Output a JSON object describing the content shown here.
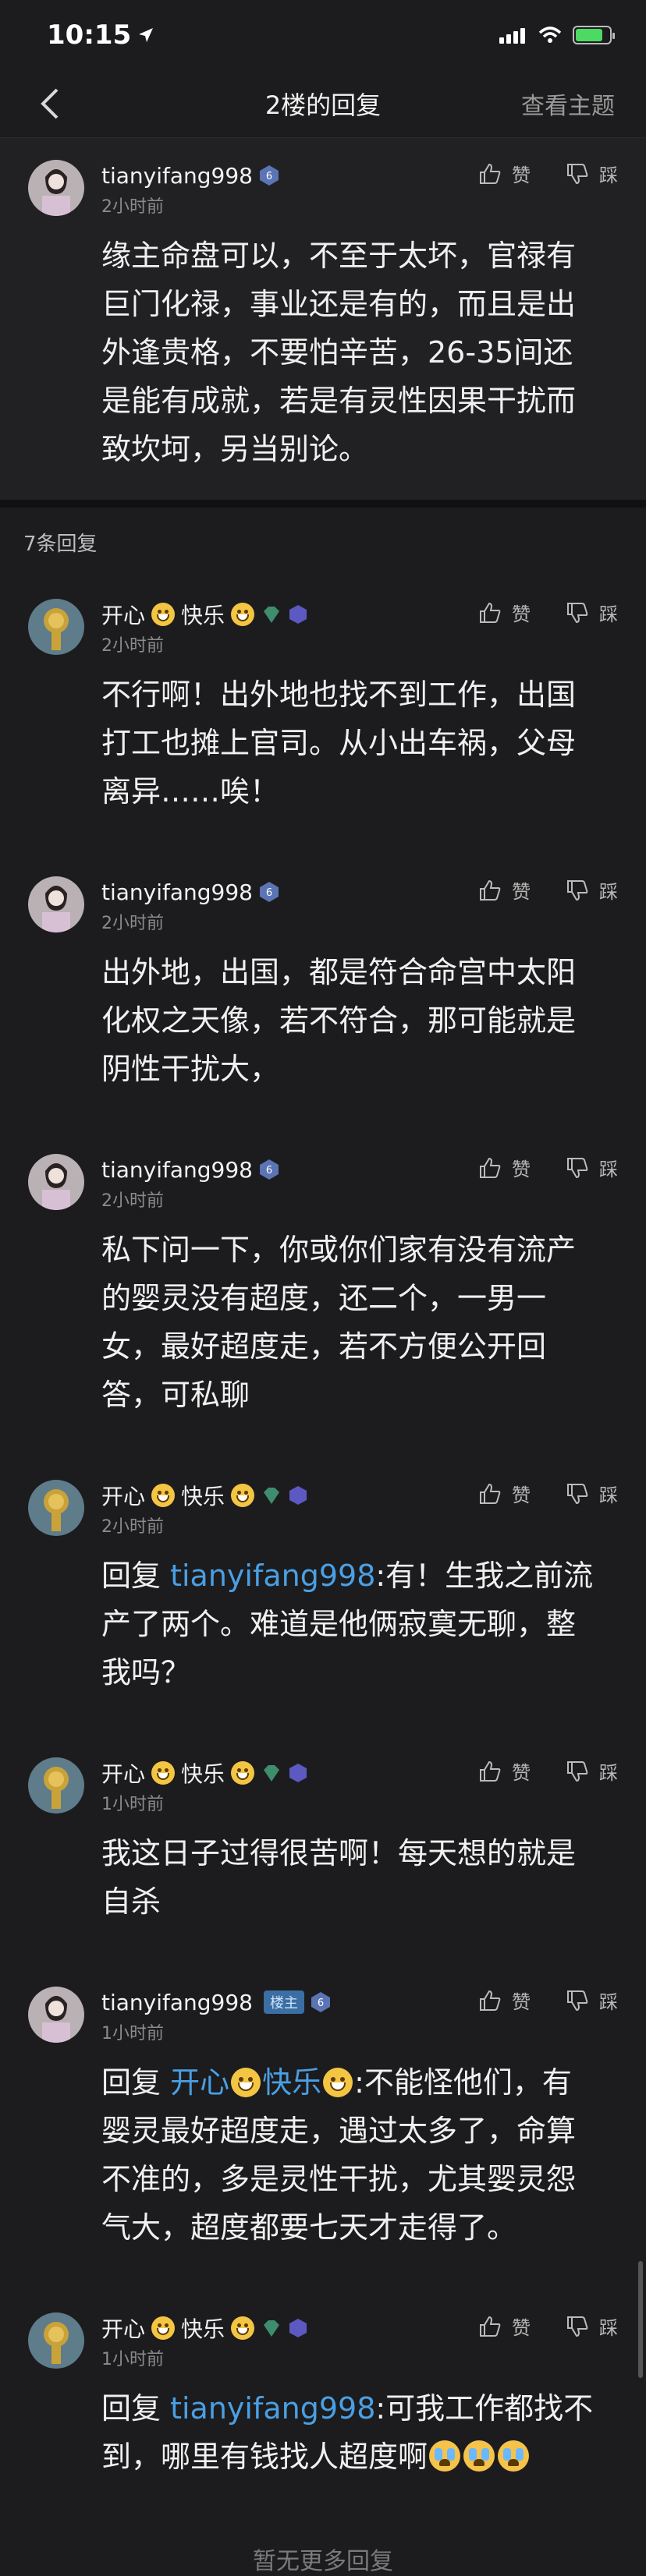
{
  "status_bar": {
    "time": "10:15"
  },
  "nav": {
    "title": "2楼的回复",
    "topic_link": "查看主题"
  },
  "op": {
    "username": "tianyifang998",
    "level": "6",
    "time": "2小时前",
    "like_label": "赞",
    "dislike_label": "踩",
    "content": "缘主命盘可以，不至于太坏，官禄有巨门化禄，事业还是有的，而且是出外逢贵格，不要怕辛苦，26-35间还是能有成就，若是有灵性因果干扰而致坎坷，另当别论。"
  },
  "replies_count": "7条回复",
  "replies": [
    {
      "user_a": "开心",
      "user_b": "快乐",
      "time": "2小时前",
      "content": "不行啊！出外地也找不到工作，出国打工也摊上官司。从小出车祸，父母离异……唉！"
    },
    {
      "username": "tianyifang998",
      "level": "6",
      "time": "2小时前",
      "content": "出外地，出国，都是符合命宫中太阳化权之天像，若不符合，那可能就是阴性干扰大，"
    },
    {
      "username": "tianyifang998",
      "level": "6",
      "time": "2小时前",
      "content": "私下问一下，你或你们家有没有流产的婴灵没有超度，还二个，一男一女，最好超度走，若不方便公开回答，可私聊"
    },
    {
      "user_a": "开心",
      "user_b": "快乐",
      "time": "2小时前",
      "reply_prefix": "回复 ",
      "mention": "tianyifang998",
      "content": ":有！生我之前流产了两个。难道是他俩寂寞无聊，整我吗？"
    },
    {
      "user_a": "开心",
      "user_b": "快乐",
      "time": "1小时前",
      "content": "我这日子过得很苦啊！每天想的就是自杀"
    },
    {
      "username": "tianyifang998",
      "owner_tag": "楼主",
      "level": "6",
      "time": "1小时前",
      "reply_prefix": "回复 ",
      "mention_a": "开心",
      "mention_b": "快乐",
      "content": ":不能怪他们，有婴灵最好超度走，遇过太多了，命算不准的，多是灵性干扰，尤其婴灵怨气大，超度都要七天才走得了。"
    },
    {
      "user_a": "开心",
      "user_b": "快乐",
      "time": "1小时前",
      "reply_prefix": "回复 ",
      "mention": "tianyifang998",
      "content": ":可我工作都找不到，哪里有钱找人超度啊"
    }
  ],
  "footer": "暂无更多回复",
  "colors": {
    "background": "#1c1c1e",
    "mention": "#4a9fe4",
    "level_badge": "#5b74b4"
  },
  "icons": [
    "location-arrow-icon",
    "signal-icon",
    "wifi-icon",
    "battery-icon",
    "back-chevron-icon",
    "like-icon",
    "dislike-icon",
    "level-badge-icon",
    "gem-icon",
    "vip-icon",
    "grin-emoji-icon",
    "cry-emoji-icon"
  ]
}
